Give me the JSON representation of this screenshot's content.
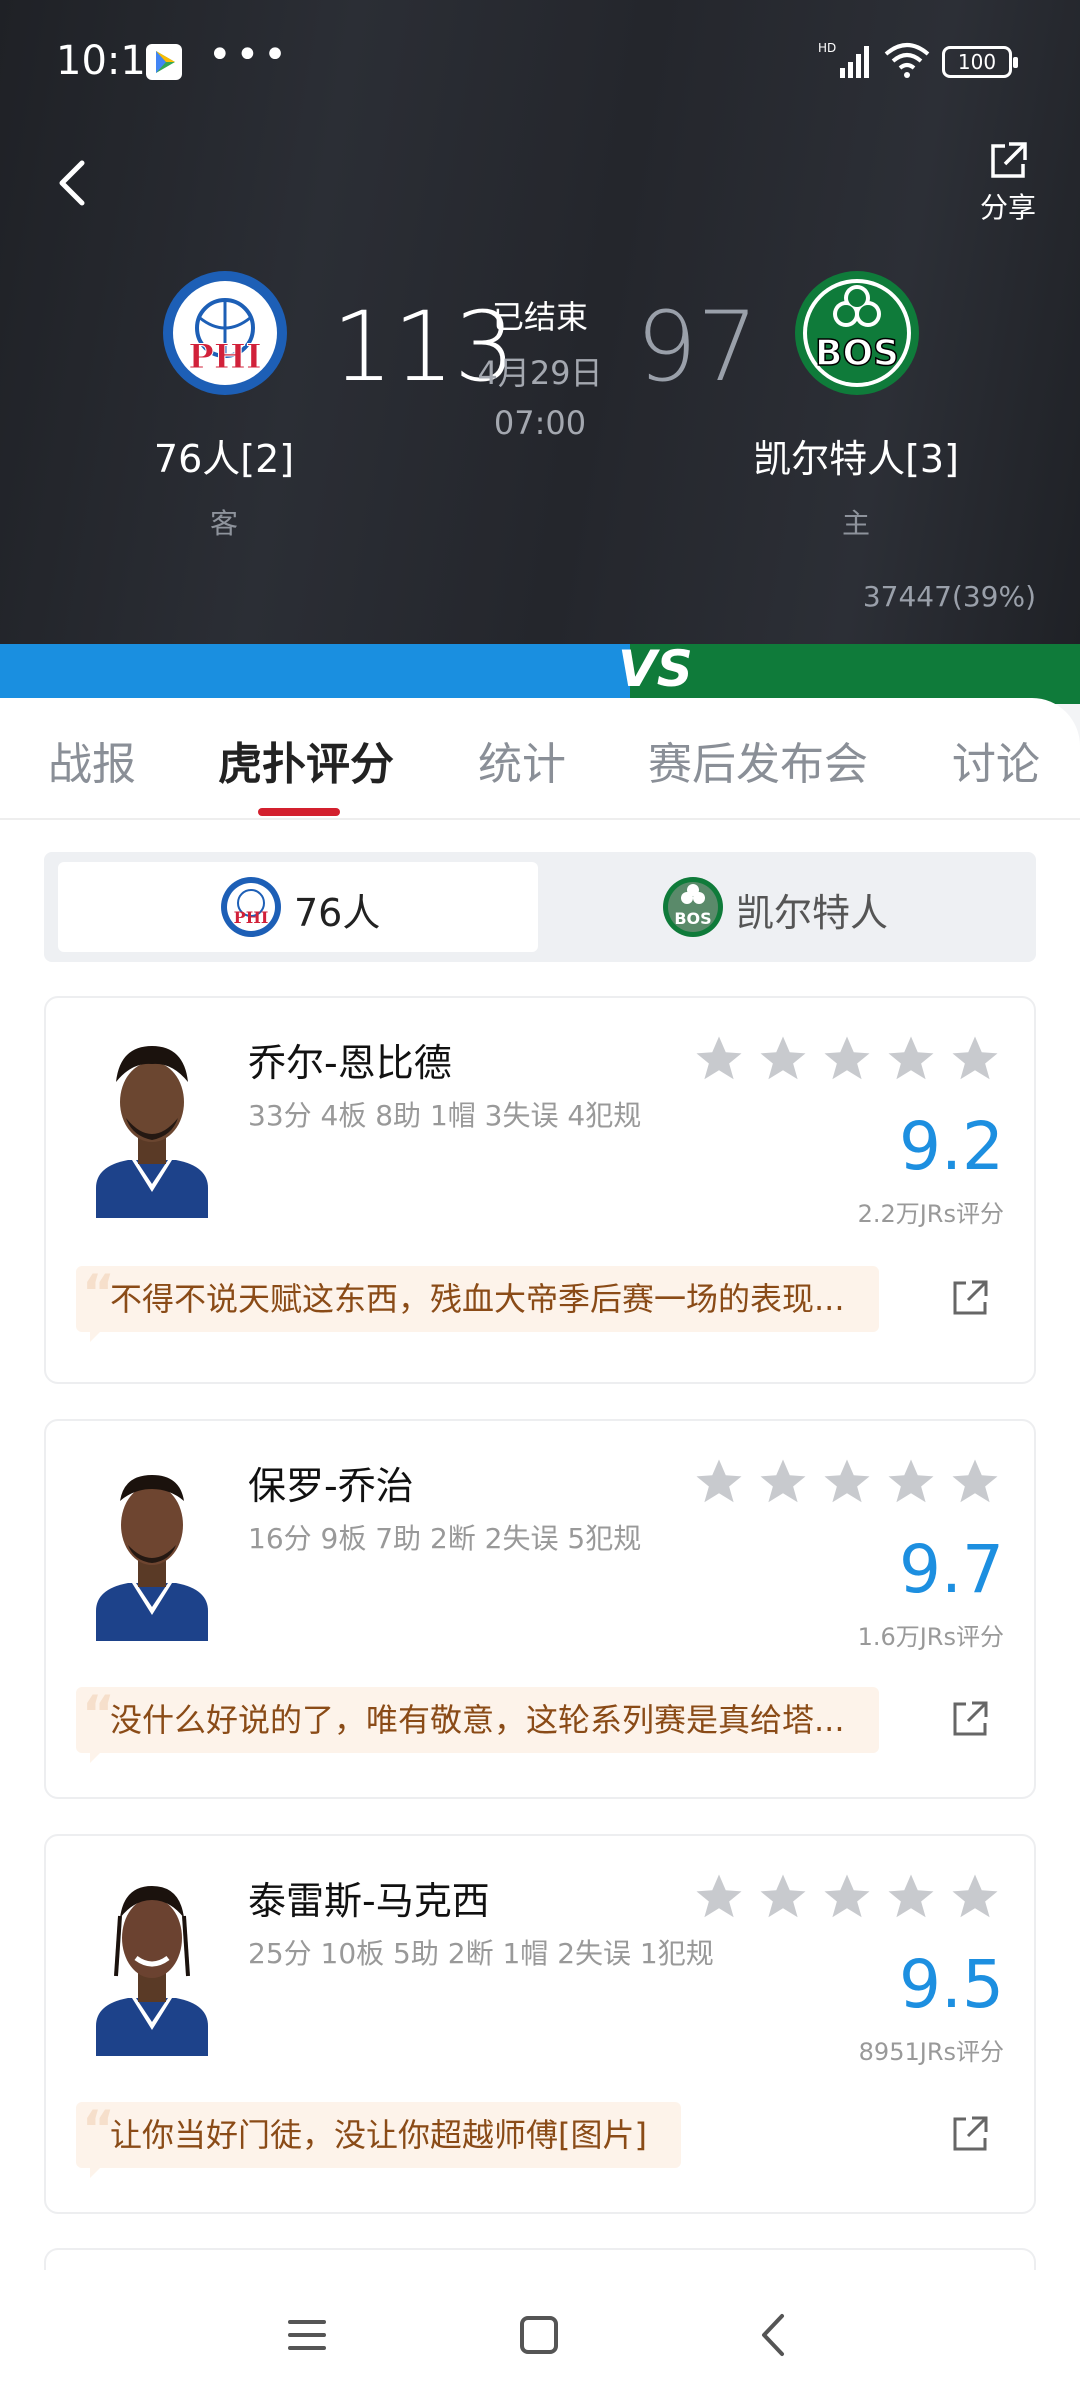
{
  "status_bar": {
    "time": "10:17",
    "battery": "100"
  },
  "header": {
    "share_label": "分享",
    "game_status": "已结束",
    "date": "4月29日",
    "time": "07:00",
    "away": {
      "name": "76人[2]",
      "role": "客",
      "score": "113",
      "abbr": "PHI"
    },
    "home": {
      "name": "凯尔特人[3]",
      "role": "主",
      "score": "97",
      "abbr": "BOS"
    },
    "vote_count": "37447(39%)"
  },
  "vs_label": "VS",
  "colors": {
    "phi_blue": "#1a8fe0",
    "bos_green": "#0f7b3a",
    "tab_indicator": "#d3202e",
    "rating": "#1d8fe0"
  },
  "tabs": [
    "战报",
    "虎扑评分",
    "统计",
    "赛后发布会",
    "讨论"
  ],
  "team_switch": {
    "selected": "76人",
    "other": "凯尔特人"
  },
  "players": [
    {
      "name": "乔尔-恩比德",
      "stats": "33分 4板 8助 1帽 3失误 4犯规",
      "rating": "9.2",
      "rating_count": "2.2万JRs评分",
      "comment": "不得不说天赋这东西，残血大帝季后赛一场的表现..."
    },
    {
      "name": "保罗-乔治",
      "stats": "16分 9板 7助 2断 2失误 5犯规",
      "rating": "9.7",
      "rating_count": "1.6万JRs评分",
      "comment": "没什么好说的了，唯有敬意，这轮系列赛是真给塔..."
    },
    {
      "name": "泰雷斯-马克西",
      "stats": "25分 10板 5助 2断 1帽 2失误 1犯规",
      "rating": "9.5",
      "rating_count": "8951JRs评分",
      "comment": "让你当好门徒，没让你超越师傅[图片]"
    }
  ]
}
